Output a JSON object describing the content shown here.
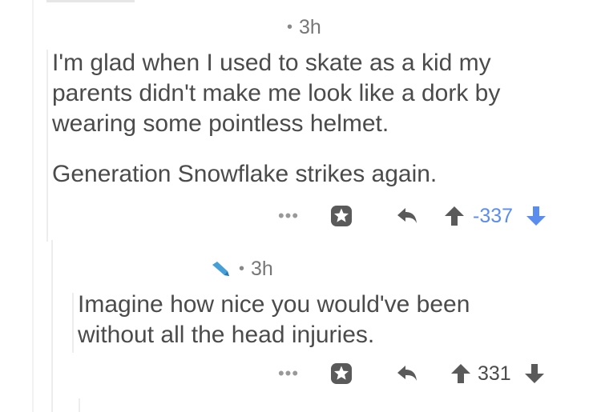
{
  "comment1": {
    "time": "3h",
    "body_lines": [
      "I'm glad when I used to skate as a kid my",
      "parents didn't make me look like a dork by",
      "wearing some pointless helmet."
    ],
    "body_line2": "Generation Snowflake strikes again.",
    "actions": {
      "more": "•••",
      "score": "-337",
      "vote_state": "downvoted"
    }
  },
  "comment2": {
    "flair_icon": "pencil-icon",
    "time": "3h",
    "body_lines": [
      "Imagine how nice you would've been",
      "without all the head injuries."
    ],
    "actions": {
      "more": "•••",
      "score": "331",
      "vote_state": "none"
    }
  },
  "colors": {
    "downvote": "#5b8def",
    "neutral_icon": "#5a5a5a",
    "text": "#4b4b4b",
    "meta": "#777777",
    "thread_line": "#ededed",
    "flair": "#46a0d8"
  }
}
